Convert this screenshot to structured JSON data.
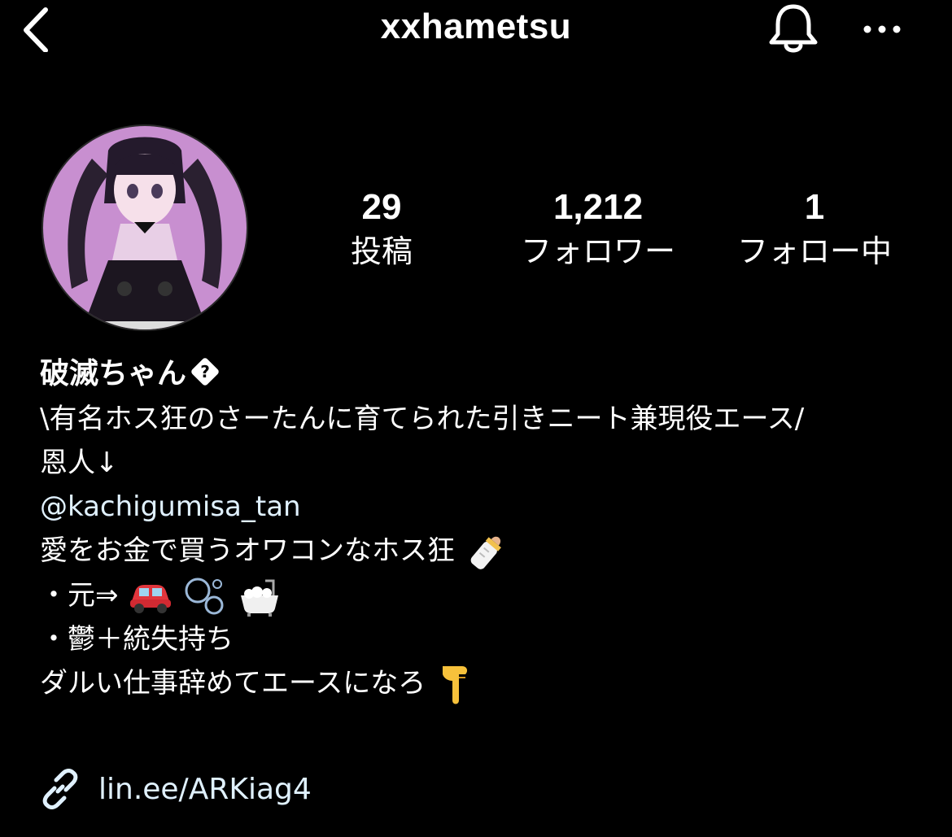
{
  "header": {
    "username": "xxhametsu",
    "back_icon": "chevron-left-icon",
    "bell_icon": "bell-icon",
    "more_icon": "more-horizontal-icon"
  },
  "profile": {
    "avatar_icon": "avatar-illustration",
    "stats": [
      {
        "value": "29",
        "label": "投稿"
      },
      {
        "value": "1,212",
        "label": "フォロワー"
      },
      {
        "value": "1",
        "label": "フォロー中"
      }
    ]
  },
  "bio": {
    "display_name": "破滅ちゃん",
    "unknown_glyph": "?",
    "line1": "\\有名ホス狂のさーたんに育てられた引きニート兼現役エース/",
    "line2": "恩人↓",
    "mention": "@kachigumisa_tan",
    "line3": "愛をお金で買うオワコンなホス狂",
    "line4": "・元⇒",
    "line5": "・鬱＋統失持ち",
    "line6": "ダルい仕事辞めてエースになろ",
    "emoji_bottle": "baby-bottle-emoji",
    "emoji_car": "car-emoji",
    "emoji_bubbles": "bubbles-emoji",
    "emoji_bathtub": "bathtub-emoji",
    "emoji_point": "pointing-down-emoji"
  },
  "link": {
    "icon": "link-icon",
    "text": "lin.ee/ARKiag4"
  },
  "colors": {
    "background": "#000000",
    "text": "#ffffff",
    "link": "#e0f1ff",
    "avatar_bg": "#c88fd0"
  }
}
